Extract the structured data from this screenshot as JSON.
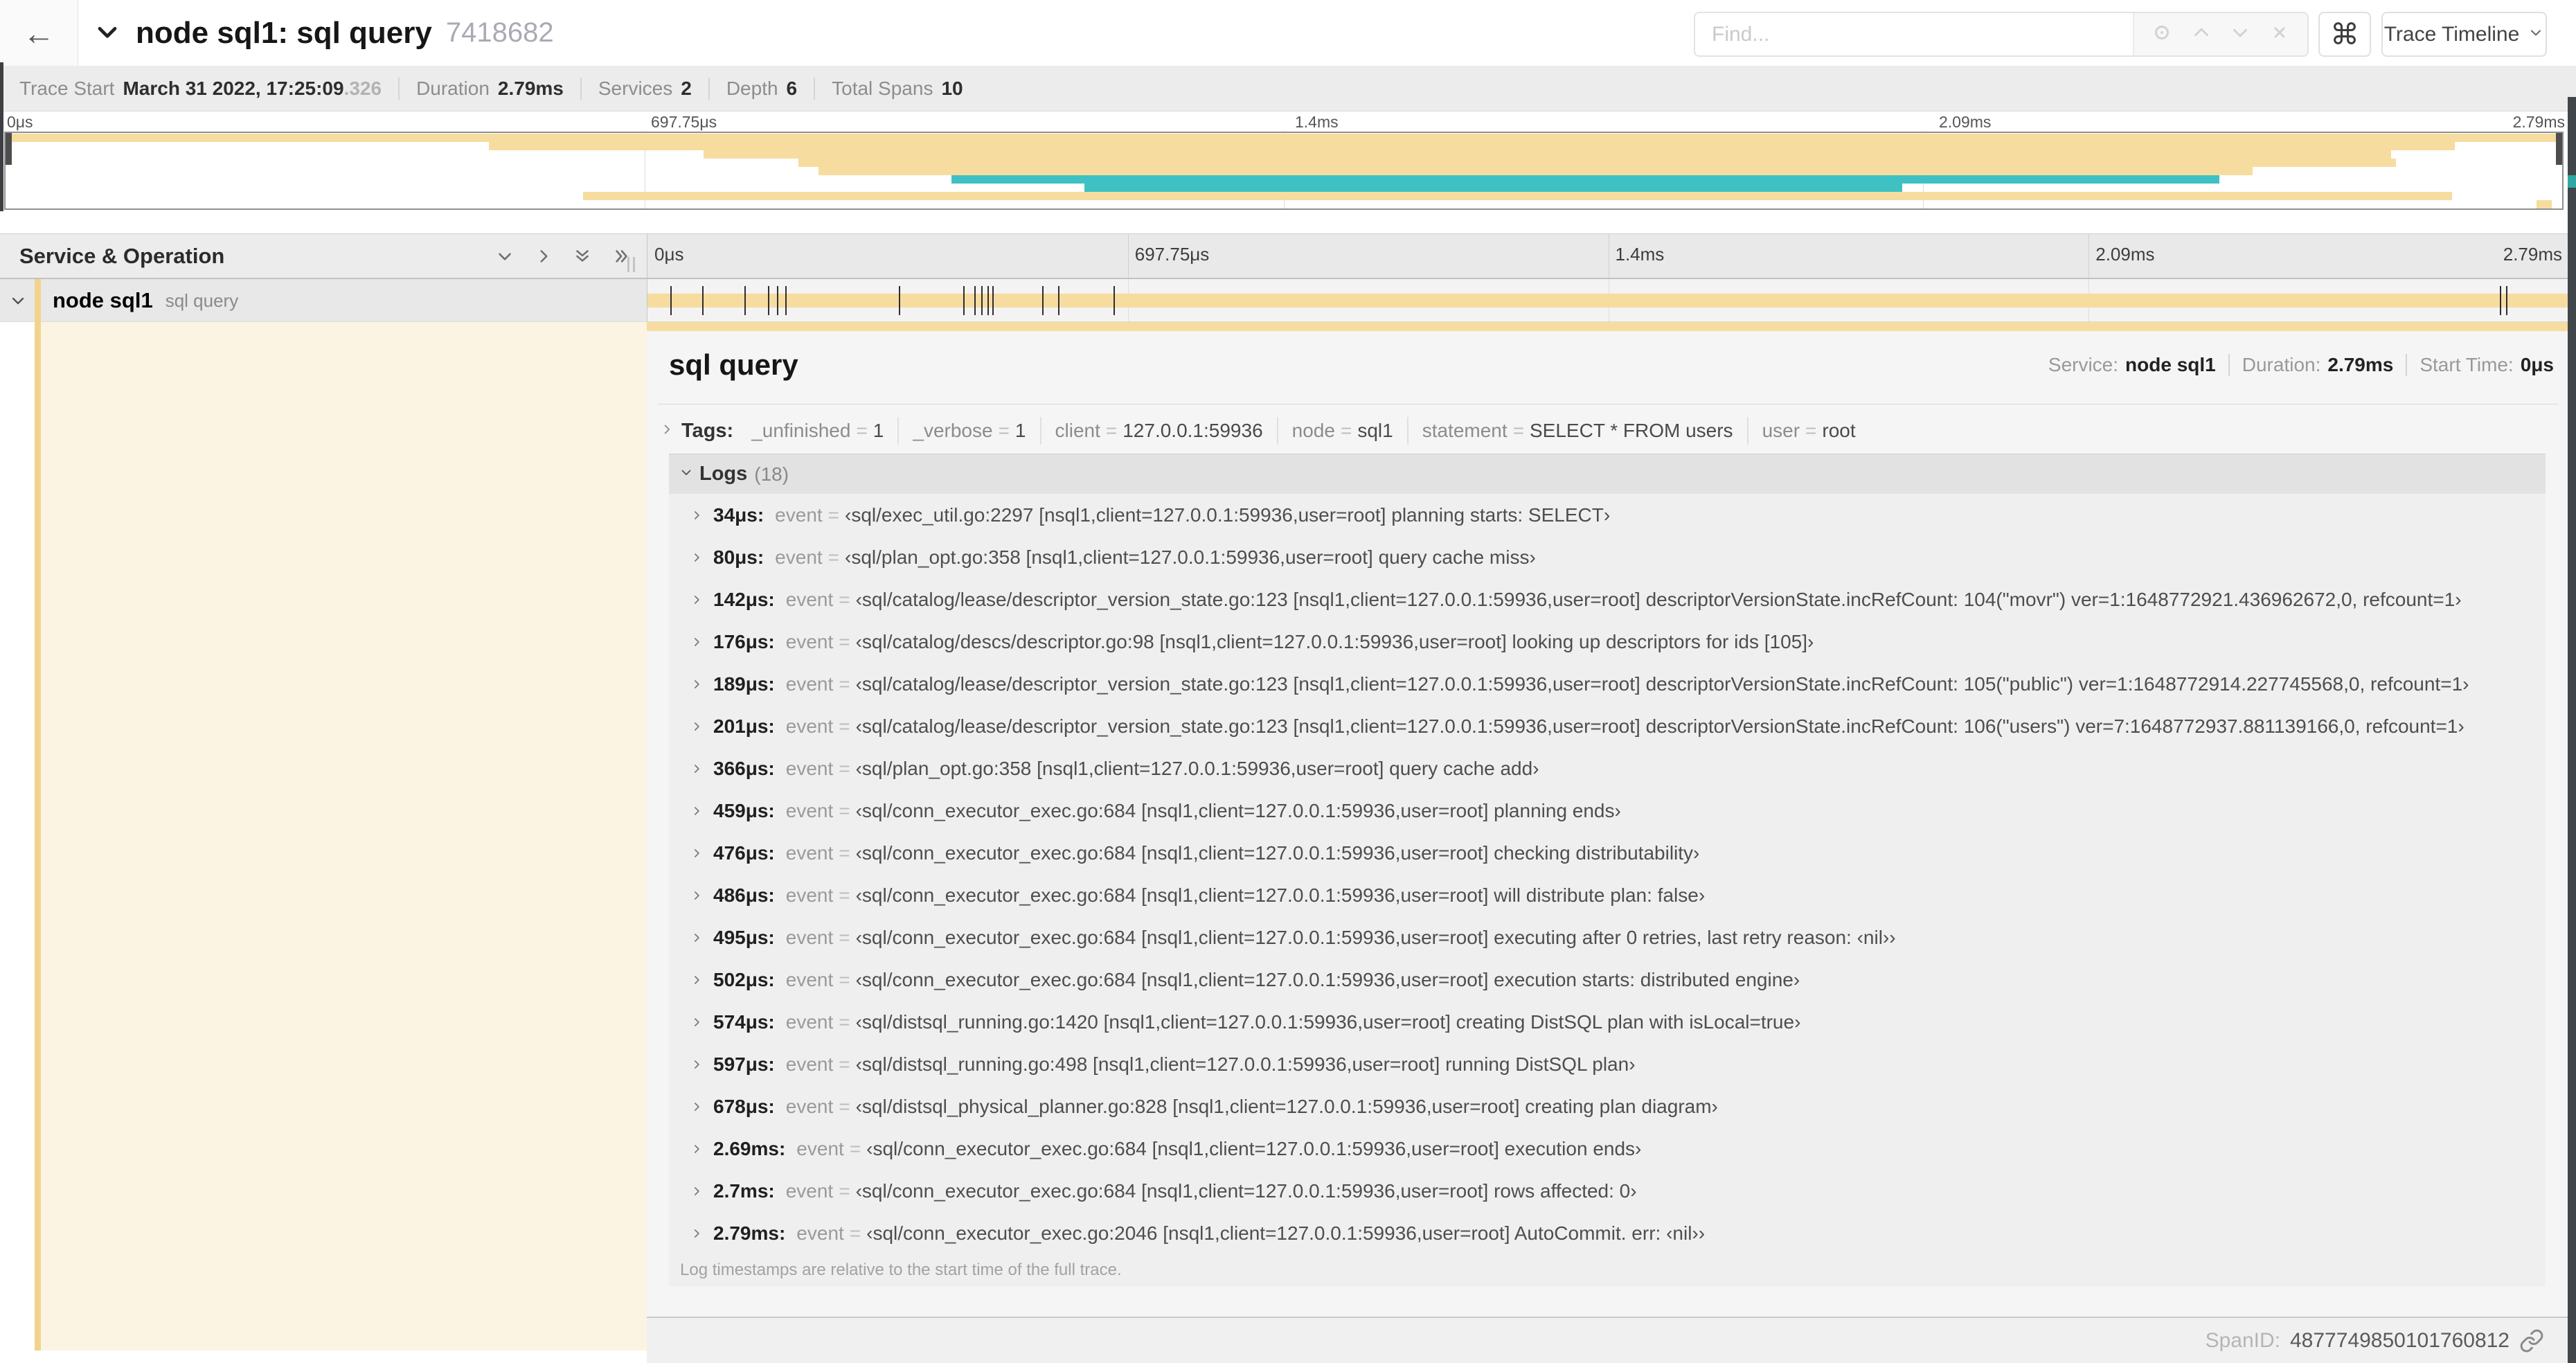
{
  "header": {
    "back_glyph": "←",
    "title": "node sql1: sql query",
    "trace_id": "7418682",
    "find_placeholder": "Find...",
    "shortcut_key": "⌘",
    "view_selector": "Trace Timeline"
  },
  "meta": {
    "items": [
      {
        "label": "Trace Start",
        "value": "March 31 2022, 17:25:09",
        "frac": ".326"
      },
      {
        "label": "Duration",
        "value": "2.79ms"
      },
      {
        "label": "Services",
        "value": "2"
      },
      {
        "label": "Depth",
        "value": "6"
      },
      {
        "label": "Total Spans",
        "value": "10"
      }
    ]
  },
  "timeline": {
    "duration_us": 2790,
    "ticks": [
      {
        "label": "0μs",
        "pct": 0
      },
      {
        "label": "697.75μs",
        "pct": 25
      },
      {
        "label": "1.4ms",
        "pct": 50
      },
      {
        "label": "2.09ms",
        "pct": 75
      },
      {
        "label": "2.79ms",
        "pct": 100
      }
    ]
  },
  "minimap": {
    "bar_colors": {
      "tan": "#f7dca0",
      "teal": "#3fc1c4"
    },
    "bars": [
      {
        "row": 0,
        "start_pct": 0,
        "end_pct": 100,
        "color": "tan"
      },
      {
        "row": 1,
        "start_pct": 18.9,
        "end_pct": 95.8,
        "color": "tan"
      },
      {
        "row": 2,
        "start_pct": 27.3,
        "end_pct": 93.3,
        "color": "tan"
      },
      {
        "row": 3,
        "start_pct": 31.0,
        "end_pct": 93.5,
        "color": "tan"
      },
      {
        "row": 4,
        "start_pct": 31.8,
        "end_pct": 87.9,
        "color": "tan"
      },
      {
        "row": 5,
        "start_pct": 37.0,
        "end_pct": 86.6,
        "color": "teal"
      },
      {
        "row": 6,
        "start_pct": 42.2,
        "end_pct": 74.2,
        "color": "teal"
      },
      {
        "row": 7,
        "start_pct": 22.6,
        "end_pct": 95.7,
        "color": "tan"
      },
      {
        "row": 8,
        "start_pct": 99.0,
        "end_pct": 99.6,
        "color": "tan"
      }
    ]
  },
  "span_table": {
    "header": "Service & Operation",
    "row": {
      "service": "node sql1",
      "operation": "sql query"
    }
  },
  "detail": {
    "title": "sql query",
    "meta": [
      {
        "label": "Service:",
        "value": "node sql1"
      },
      {
        "label": "Duration:",
        "value": "2.79ms"
      },
      {
        "label": "Start Time:",
        "value": "0μs"
      }
    ],
    "tags_label": "Tags:",
    "eq": "=",
    "tags": [
      {
        "key": "_unfinished",
        "value": "1"
      },
      {
        "key": "_verbose",
        "value": "1"
      },
      {
        "key": "client",
        "value": "127.0.0.1:59936"
      },
      {
        "key": "node",
        "value": "sql1"
      },
      {
        "key": "statement",
        "value": "SELECT * FROM users"
      },
      {
        "key": "user",
        "value": "root"
      }
    ],
    "logs_label": "Logs",
    "logs_count": "(18)",
    "log_key": "event",
    "logs": [
      {
        "time": "34μs:",
        "us": 34,
        "value": "‹sql/exec_util.go:2297 [nsql1,client=127.0.0.1:59936,user=root] planning starts: SELECT›"
      },
      {
        "time": "80μs:",
        "us": 80,
        "value": "‹sql/plan_opt.go:358 [nsql1,client=127.0.0.1:59936,user=root] query cache miss›"
      },
      {
        "time": "142μs:",
        "us": 142,
        "value": "‹sql/catalog/lease/descriptor_version_state.go:123 [nsql1,client=127.0.0.1:59936,user=root] descriptorVersionState.incRefCount: 104(\"movr\") ver=1:1648772921.436962672,0, refcount=1›"
      },
      {
        "time": "176μs:",
        "us": 176,
        "value": "‹sql/catalog/descs/descriptor.go:98 [nsql1,client=127.0.0.1:59936,user=root] looking up descriptors for ids [105]›"
      },
      {
        "time": "189μs:",
        "us": 189,
        "value": "‹sql/catalog/lease/descriptor_version_state.go:123 [nsql1,client=127.0.0.1:59936,user=root] descriptorVersionState.incRefCount: 105(\"public\") ver=1:1648772914.227745568,0, refcount=1›"
      },
      {
        "time": "201μs:",
        "us": 201,
        "value": "‹sql/catalog/lease/descriptor_version_state.go:123 [nsql1,client=127.0.0.1:59936,user=root] descriptorVersionState.incRefCount: 106(\"users\") ver=7:1648772937.881139166,0, refcount=1›"
      },
      {
        "time": "366μs:",
        "us": 366,
        "value": "‹sql/plan_opt.go:358 [nsql1,client=127.0.0.1:59936,user=root] query cache add›"
      },
      {
        "time": "459μs:",
        "us": 459,
        "value": "‹sql/conn_executor_exec.go:684 [nsql1,client=127.0.0.1:59936,user=root] planning ends›"
      },
      {
        "time": "476μs:",
        "us": 476,
        "value": "‹sql/conn_executor_exec.go:684 [nsql1,client=127.0.0.1:59936,user=root] checking distributability›"
      },
      {
        "time": "486μs:",
        "us": 486,
        "value": "‹sql/conn_executor_exec.go:684 [nsql1,client=127.0.0.1:59936,user=root] will distribute plan: false›"
      },
      {
        "time": "495μs:",
        "us": 495,
        "value": "‹sql/conn_executor_exec.go:684 [nsql1,client=127.0.0.1:59936,user=root] executing after 0 retries, last retry reason: ‹nil››"
      },
      {
        "time": "502μs:",
        "us": 502,
        "value": "‹sql/conn_executor_exec.go:684 [nsql1,client=127.0.0.1:59936,user=root] execution starts: distributed engine›"
      },
      {
        "time": "574μs:",
        "us": 574,
        "value": "‹sql/distsql_running.go:1420 [nsql1,client=127.0.0.1:59936,user=root] creating DistSQL plan with isLocal=true›"
      },
      {
        "time": "597μs:",
        "us": 597,
        "value": "‹sql/distsql_running.go:498 [nsql1,client=127.0.0.1:59936,user=root] running DistSQL plan›"
      },
      {
        "time": "678μs:",
        "us": 678,
        "value": "‹sql/distsql_physical_planner.go:828 [nsql1,client=127.0.0.1:59936,user=root] creating plan diagram›"
      },
      {
        "time": "2.69ms:",
        "us": 2690,
        "value": "‹sql/conn_executor_exec.go:684 [nsql1,client=127.0.0.1:59936,user=root] execution ends›"
      },
      {
        "time": "2.7ms:",
        "us": 2700,
        "value": "‹sql/conn_executor_exec.go:684 [nsql1,client=127.0.0.1:59936,user=root] rows affected: 0›"
      },
      {
        "time": "2.79ms:",
        "us": 2790,
        "value": "‹sql/conn_executor_exec.go:2046 [nsql1,client=127.0.0.1:59936,user=root] AutoCommit. err: ‹nil››"
      }
    ],
    "note": "Log timestamps are relative to the start time of the full trace.",
    "spanid_label": "SpanID:",
    "spanid_value": "4877749850101760812"
  }
}
